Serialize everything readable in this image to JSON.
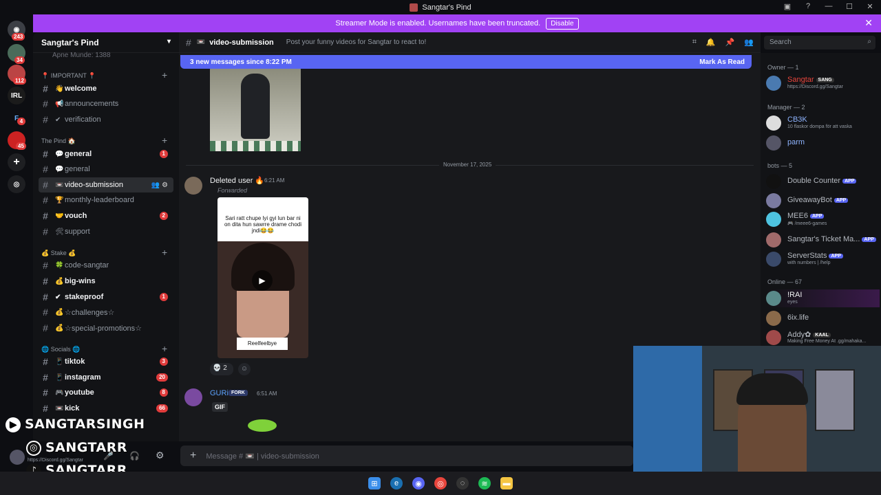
{
  "window": {
    "title": "Sangtar's Pind"
  },
  "banner": {
    "text": "Streamer Mode is enabled. Usernames have been truncated.",
    "button": "Disable"
  },
  "servers": [
    {
      "label": "",
      "badge": "243"
    },
    {
      "label": "",
      "badge": "34"
    },
    {
      "label": "",
      "badge": "112"
    },
    {
      "label": "IRL",
      "badge": ""
    },
    {
      "label": "F",
      "badge": "4"
    },
    {
      "label": "",
      "badge": "45"
    }
  ],
  "sidebar": {
    "server_name": "Sangtar's Pind",
    "partial_top": "Apne Munde: 1388",
    "categories": {
      "important": "📍 IMPORTANT 📍",
      "pind": "The Pind 🏠",
      "stake": "💰 Stake 💰",
      "socials": "🌐 Socials 🌐"
    },
    "channels": [
      {
        "name": "welcome",
        "emoji": "👋"
      },
      {
        "name": "announcements",
        "emoji": "📢"
      },
      {
        "name": "verification",
        "emoji": "✔"
      },
      {
        "name": "general",
        "emoji": "💬",
        "badge": "1"
      },
      {
        "name": "general",
        "emoji": "💬"
      },
      {
        "name": "video-submission",
        "emoji": "📼"
      },
      {
        "name": "monthly-leaderboard",
        "emoji": "🏆"
      },
      {
        "name": "vouch",
        "emoji": "🤝",
        "badge": "2"
      },
      {
        "name": "support",
        "emoji": "🛠"
      },
      {
        "name": "code-sangtar",
        "emoji": "🍀"
      },
      {
        "name": "big-wins",
        "emoji": "💰"
      },
      {
        "name": "stakeproof",
        "emoji": "✔",
        "badge": "1"
      },
      {
        "name": "☆challenges☆",
        "emoji": "💰"
      },
      {
        "name": "☆special-promotions☆",
        "emoji": "💰"
      },
      {
        "name": "tiktok",
        "emoji": "📱",
        "badge": "3"
      },
      {
        "name": "instagram",
        "emoji": "📱",
        "badge": "20"
      },
      {
        "name": "youtube",
        "emoji": "🎮",
        "badge": "8"
      },
      {
        "name": "kick",
        "emoji": "📼",
        "badge": "66"
      }
    ]
  },
  "channel": {
    "name": "video-submission",
    "topic": "Post your funny videos for Sangtar to react to!",
    "new_messages": "3 new messages since 8:22 PM",
    "mark_read": "Mark As Read",
    "search_placeholder": "Search",
    "composer_placeholder": "Message # 📼 | video-submission"
  },
  "messages": {
    "date_divider": "November 17, 2025",
    "m1": {
      "author": "Deleted user 🔥",
      "time": "6:21 AM",
      "forwarded": "Forwarded",
      "caption": "Sari ratt chupe lyi gyi lun bar ni on dita hun sawrre drame chodi jndi😂😂",
      "watermark": "Reelfeelbye",
      "reaction_count": "2"
    },
    "m2": {
      "author": "GURi",
      "tag": "FORK",
      "time": "6:51 AM",
      "gif": "GIF"
    }
  },
  "members": {
    "owner_cat": "Owner — 1",
    "manager_cat": "Manager — 2",
    "bots_cat": "bots — 5",
    "online_cat": "Online — 67",
    "list": [
      {
        "name": "Sangtar",
        "tag": "SANG",
        "status": "https://Discord.gg/Sangtar"
      },
      {
        "name": "CB3K",
        "status": "10 flaskor dompa för att vaska"
      },
      {
        "name": "parm",
        "status": ""
      },
      {
        "name": "Double Counter",
        "tag": "APP",
        "status": ""
      },
      {
        "name": "GiveawayBot",
        "tag": "APP",
        "status": ""
      },
      {
        "name": "MEE6",
        "tag": "APP",
        "status": "🎮 /meee6-games"
      },
      {
        "name": "Sangtar's Ticket Ma...",
        "tag": "APP",
        "status": ""
      },
      {
        "name": "ServerStats",
        "tag": "APP",
        "status": "with numbers | /help"
      },
      {
        "name": "!RAI",
        "status": "eyes"
      },
      {
        "name": "6ix.life",
        "status": ""
      },
      {
        "name": "Addy✿",
        "tag": "KAAL",
        "status": "Making Free Money At .gg/mahaka..."
      }
    ]
  },
  "overlay": {
    "yt": "SANGTARSINGH",
    "ig": "SANGTARR",
    "tt": "SANGTARR"
  },
  "userpanel": {
    "status": "https://Discord.gg/Sangtar"
  }
}
